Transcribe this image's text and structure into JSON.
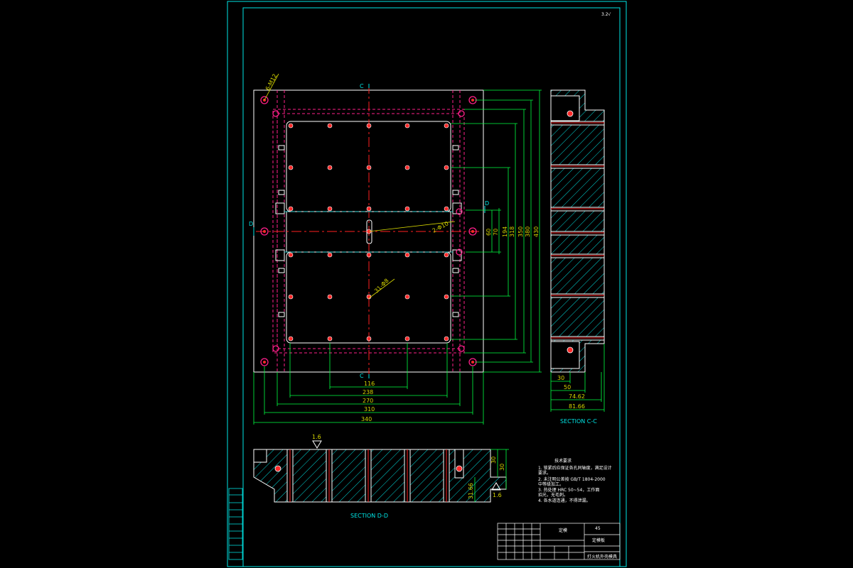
{
  "drawing": {
    "colors": {
      "background": "#000000",
      "border": "#00e6e6",
      "outline": "#ffffff",
      "hidden": "#ff1f8a",
      "center": "#ff2020",
      "dimension": "#00ff40",
      "dim_text": "#d6d600",
      "hatch": "#00d8d8",
      "hole": "#ff2a2a"
    },
    "corner_mark": "3.2√",
    "plan_view": {
      "section_mark_c": "C",
      "section_mark_d": "D",
      "callouts": {
        "corner_holes": "6-M12",
        "center_holes": "2-Φ10",
        "grid_holes": "31-Φ8"
      },
      "bottom_dims": [
        "116",
        "238",
        "270",
        "310",
        "340"
      ],
      "right_dims": [
        "60",
        "70",
        "194",
        "318",
        "350",
        "380",
        "430"
      ]
    },
    "section_cc": {
      "title": "SECTION C-C",
      "dims": [
        "30",
        "50",
        "74.62",
        "81.66"
      ]
    },
    "section_dd": {
      "title": "SECTION D-D",
      "roughness": [
        "1.6",
        "1.6"
      ],
      "dims": [
        "30",
        "30",
        "31.66"
      ]
    },
    "notes": {
      "title": "技术要求",
      "items": [
        "1. 锁紧后应保证各孔同轴度，满足设计",
        "   要求。",
        "2. 未注明公差按 GB/T 1804-2000",
        "   中等级加工。",
        "3. 热处理 HRC 50~54，工作面",
        "   招光，无毛刺。",
        "4. 各水道连通，不得泄漏。"
      ]
    },
    "title_block": {
      "name": "定模板",
      "material": "45",
      "part": "定模",
      "drawing_title": "打火机外壳模具"
    }
  }
}
